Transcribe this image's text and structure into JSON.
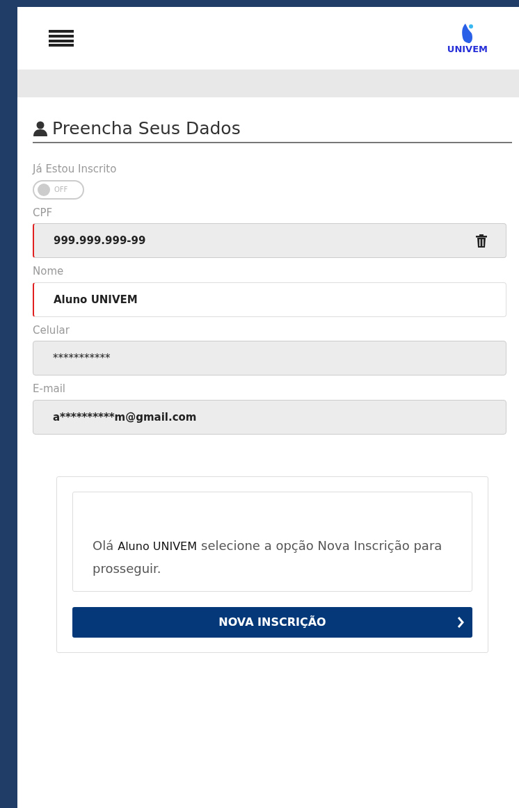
{
  "header": {
    "logo_text": "UNIVEM"
  },
  "section_title": "Preencha Seus Dados",
  "toggle": {
    "label": "Já Estou Inscrito",
    "on": false,
    "state_text": "OFF"
  },
  "fields": [
    {
      "label": "CPF",
      "value": "999.999.999-99",
      "readonly": true,
      "invalid": true,
      "clearable": true,
      "bold": true
    },
    {
      "label": "Nome",
      "value": "Aluno UNIVEM",
      "readonly": false,
      "invalid": true,
      "clearable": false,
      "bold": true
    },
    {
      "label": "Celular",
      "value": "***********",
      "readonly": true,
      "invalid": false,
      "clearable": false,
      "bold": false
    },
    {
      "label": "E-mail",
      "value": "a**********m@gmail.com",
      "readonly": true,
      "invalid": false,
      "clearable": false,
      "bold": true
    }
  ],
  "message": {
    "before": "Olá",
    "name": "Aluno UNIVEM",
    "after": "selecione a opção Nova Inscrição para prosseguir."
  },
  "button": {
    "label": "NOVA INSCRIÇÃO"
  }
}
